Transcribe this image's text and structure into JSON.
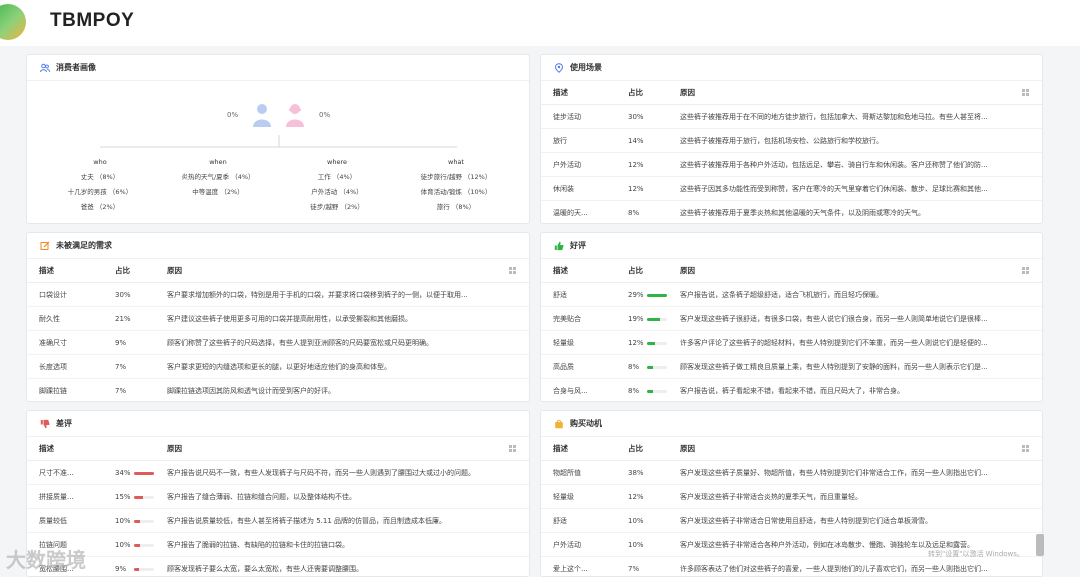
{
  "app": {
    "title": "TBMPOY"
  },
  "colors": {
    "green": "#2fb344",
    "red": "#e05a5a",
    "blue_icon": "#4f7be8",
    "female": "#f06fae"
  },
  "persona": {
    "title": "消费者画像",
    "male_pct": "0%",
    "female_pct": "0%",
    "columns": [
      {
        "heading": "who",
        "items": [
          "丈夫 （8%）",
          "十几岁的男孩 （6%）",
          "爸爸 （2%）"
        ]
      },
      {
        "heading": "when",
        "items": [
          "炎热的天气/夏季 （4%）",
          "中等温度 （2%）"
        ]
      },
      {
        "heading": "where",
        "items": [
          "工作 （4%）",
          "户外活动 （4%）",
          "徒步/越野 （2%）"
        ]
      },
      {
        "heading": "what",
        "items": [
          "徒步旅行/越野 （12%）",
          "体育活动/锻炼 （10%）",
          "旅行 （8%）"
        ]
      }
    ]
  },
  "usage": {
    "title": "使用场景",
    "headers": [
      "描述",
      "占比",
      "原因"
    ],
    "rows": [
      {
        "desc": "徒步活动",
        "pct": "30%",
        "reason": "这些裤子被推荐用于在不同的地方徒步旅行，包括加拿大、哥斯达黎加和危地马拉。有些人甚至将..."
      },
      {
        "desc": "旅行",
        "pct": "14%",
        "reason": "这些裤子被推荐用于旅行，包括机场安检、公路旅行和学校旅行。"
      },
      {
        "desc": "户外活动",
        "pct": "12%",
        "reason": "这些裤子被推荐用于各种户外活动，包括远足、攀岩、骑自行车和休闲装。客户还称赞了他们的防..."
      },
      {
        "desc": "休闲装",
        "pct": "12%",
        "reason": "这些裤子因其多功能性而受到称赞，客户在寒冷的天气里穿着它们休闲装、散步、足球比赛和其他..."
      },
      {
        "desc": "温暖的天...",
        "pct": "8%",
        "reason": "这些裤子被推荐用于夏季炎热和其他温暖的天气条件，以及阴雨或寒冷的天气。"
      }
    ]
  },
  "unmet": {
    "title": "未被满足的需求",
    "headers": [
      "描述",
      "占比",
      "原因"
    ],
    "rows": [
      {
        "desc": "口袋设计",
        "pct": "30%",
        "reason": "客户要求增加额外的口袋，特别是用于手机的口袋，并要求将口袋移到裤子的一侧，以便于取用..."
      },
      {
        "desc": "耐久性",
        "pct": "21%",
        "reason": "客户建议这些裤子使用更多可用的口袋并提高耐用性，以承受撕裂和其他磨损。"
      },
      {
        "desc": "准确尺寸",
        "pct": "9%",
        "reason": "顾客们称赞了这些裤子的尺码选择，有些人提到亚洲顾客的尺码要宽松或尺码更明确。"
      },
      {
        "desc": "长度选项",
        "pct": "7%",
        "reason": "客户要求更短的内缝选项和更长的腿，以更好地适应他们的身高和体型。"
      },
      {
        "desc": "脚踝拉链",
        "pct": "7%",
        "reason": "脚踝拉链选项因其防风和透气设计而受到客户的好评。"
      }
    ]
  },
  "positive": {
    "title": "好评",
    "headers": [
      "描述",
      "占比",
      "原因"
    ],
    "rows": [
      {
        "desc": "舒适",
        "pct": "29%",
        "pct_value": 29,
        "reason": "客户报告说，这条裤子超级舒适，适合飞机旅行，而且轻巧保暖。"
      },
      {
        "desc": "完美贴合",
        "pct": "19%",
        "pct_value": 19,
        "reason": "客户发现这些裤子很舒适，有很多口袋，有些人说它们很合身，而另一些人则简单地说它们是很棒..."
      },
      {
        "desc": "轻量级",
        "pct": "12%",
        "pct_value": 12,
        "reason": "许多客户评论了这些裤子的超轻材料，有些人特别提到它们不笨重，而另一些人则说它们是轻便的..."
      },
      {
        "desc": "高品质",
        "pct": "8%",
        "pct_value": 8,
        "reason": "顾客发现这些裤子做工精良且质量上乘，有些人特别提到了安静的面料，而另一些人则表示它们是..."
      },
      {
        "desc": "合身与风...",
        "pct": "8%",
        "pct_value": 8,
        "reason": "客户报告说，裤子看起来不错，看起来不错，而且尺码大了，非常合身。"
      }
    ]
  },
  "negative": {
    "title": "差评",
    "headers": [
      "描述",
      "原因"
    ],
    "rows": [
      {
        "desc": "尺寸不准...",
        "pct": "34%",
        "pct_value": 34,
        "reason": "客户报告说尺码不一致，有些人发现裤子与尺码不符，而另一些人则遇到了腰围过大或过小的问题。"
      },
      {
        "desc": "拼接质量...",
        "pct": "15%",
        "pct_value": 15,
        "reason": "客户报告了缝合薄弱、拉链和缝合问题，以及整体结构不佳。"
      },
      {
        "desc": "质量较低",
        "pct": "10%",
        "pct_value": 10,
        "reason": "客户报告说质量较低，有些人甚至将裤子描述为 5.11 品牌的仿冒品，而且制造成本低廉。"
      },
      {
        "desc": "拉链问题",
        "pct": "10%",
        "pct_value": 10,
        "reason": "客户报告了脆弱的拉链、有缺陷的拉链和卡住的拉链口袋。"
      },
      {
        "desc": "宽松腰围...",
        "pct": "9%",
        "pct_value": 9,
        "reason": "顾客发现裤子要么太宽，要么太宽松，有些人还需要调整腰围。"
      }
    ]
  },
  "motivation": {
    "title": "购买动机",
    "headers": [
      "描述",
      "占比",
      "原因"
    ],
    "rows": [
      {
        "desc": "物超所值",
        "pct": "38%",
        "reason": "客户发现这些裤子质量好、物超所值，有些人特别提到它们非常适合工作，而另一些人则指出它们..."
      },
      {
        "desc": "轻量级",
        "pct": "12%",
        "reason": "客户发现这些裤子非常适合炎热的夏季天气，而且重量轻。"
      },
      {
        "desc": "舒适",
        "pct": "10%",
        "reason": "客户发现这些裤子非常适合日常使用且舒适，有些人特别提到它们适合单板滑雪。"
      },
      {
        "desc": "户外活动",
        "pct": "10%",
        "reason": "客户发现这些裤子非常适合各种户外活动，例如在冰岛散步、慢跑、骑独轮车以及远足和露营。"
      },
      {
        "desc": "爱上这个...",
        "pct": "7%",
        "reason": "许多顾客表达了他们对这些裤子的喜爱，一些人提到他们的儿子喜欢它们，而另一些人则指出它们..."
      }
    ]
  },
  "watermarks": {
    "brand": "大数跨境",
    "win": "转到\"设置\"以激活 Windows。"
  }
}
